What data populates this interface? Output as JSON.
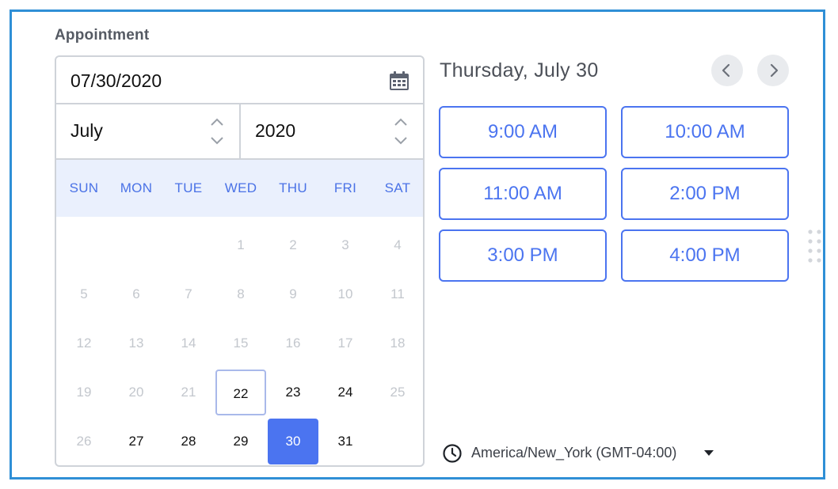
{
  "field": {
    "label": "Appointment"
  },
  "date_input": {
    "value": "07/30/2020"
  },
  "month_select": {
    "value": "July"
  },
  "year_select": {
    "value": "2020"
  },
  "weekdays": [
    "SUN",
    "MON",
    "TUE",
    "WED",
    "THU",
    "FRI",
    "SAT"
  ],
  "calendar": {
    "weeks": [
      [
        {
          "label": "",
          "state": "empty"
        },
        {
          "label": "",
          "state": "empty"
        },
        {
          "label": "",
          "state": "empty"
        },
        {
          "label": "1",
          "state": "disabled"
        },
        {
          "label": "2",
          "state": "disabled"
        },
        {
          "label": "3",
          "state": "disabled"
        },
        {
          "label": "4",
          "state": "disabled"
        }
      ],
      [
        {
          "label": "5",
          "state": "disabled"
        },
        {
          "label": "6",
          "state": "disabled"
        },
        {
          "label": "7",
          "state": "disabled"
        },
        {
          "label": "8",
          "state": "disabled"
        },
        {
          "label": "9",
          "state": "disabled"
        },
        {
          "label": "10",
          "state": "disabled"
        },
        {
          "label": "11",
          "state": "disabled"
        }
      ],
      [
        {
          "label": "12",
          "state": "disabled"
        },
        {
          "label": "13",
          "state": "disabled"
        },
        {
          "label": "14",
          "state": "disabled"
        },
        {
          "label": "15",
          "state": "disabled"
        },
        {
          "label": "16",
          "state": "disabled"
        },
        {
          "label": "17",
          "state": "disabled"
        },
        {
          "label": "18",
          "state": "disabled"
        }
      ],
      [
        {
          "label": "19",
          "state": "disabled"
        },
        {
          "label": "20",
          "state": "disabled"
        },
        {
          "label": "21",
          "state": "disabled"
        },
        {
          "label": "22",
          "state": "today"
        },
        {
          "label": "23",
          "state": "available"
        },
        {
          "label": "24",
          "state": "available"
        },
        {
          "label": "25",
          "state": "disabled"
        }
      ],
      [
        {
          "label": "26",
          "state": "disabled"
        },
        {
          "label": "27",
          "state": "available"
        },
        {
          "label": "28",
          "state": "available"
        },
        {
          "label": "29",
          "state": "available"
        },
        {
          "label": "30",
          "state": "selected"
        },
        {
          "label": "31",
          "state": "available"
        },
        {
          "label": "",
          "state": "empty"
        }
      ]
    ]
  },
  "schedule": {
    "heading": "Thursday, July 30",
    "slots": [
      "9:00 AM",
      "10:00 AM",
      "11:00 AM",
      "2:00 PM",
      "3:00 PM",
      "4:00 PM"
    ]
  },
  "timezone": {
    "label": "America/New_York (GMT-04:00)"
  },
  "icons": {
    "calendar": "calendar-icon",
    "spinner": "chevron-up-down-icon",
    "prev": "chevron-left-icon",
    "next": "chevron-right-icon",
    "drag": "drag-handle-icon",
    "clock": "clock-icon",
    "caret": "caret-down-icon"
  },
  "colors": {
    "accent": "#4b74f0",
    "frame_border": "#2f8fd6",
    "weekday_header_bg": "#eaf0fd",
    "disabled_text": "#c3c7cd"
  }
}
